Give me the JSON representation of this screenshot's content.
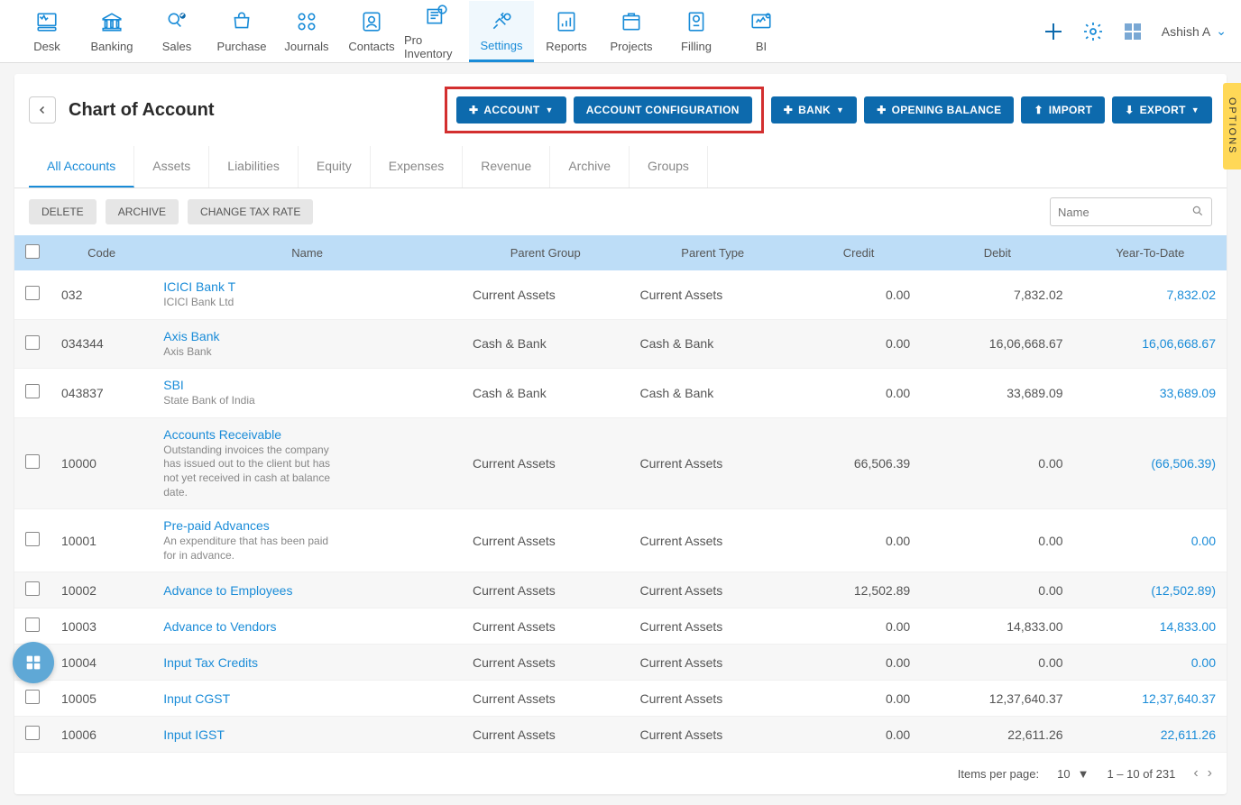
{
  "nav": {
    "items": [
      {
        "label": "Desk"
      },
      {
        "label": "Banking"
      },
      {
        "label": "Sales"
      },
      {
        "label": "Purchase"
      },
      {
        "label": "Journals"
      },
      {
        "label": "Contacts"
      },
      {
        "label": "Pro Inventory"
      },
      {
        "label": "Settings"
      },
      {
        "label": "Reports"
      },
      {
        "label": "Projects"
      },
      {
        "label": "Filling"
      },
      {
        "label": "BI"
      }
    ],
    "user": "Ashish A"
  },
  "page_title": "Chart of Account",
  "actions": {
    "account": "ACCOUNT",
    "config": "ACCOUNT CONFIGURATION",
    "bank": "BANK",
    "opening": "OPENING BALANCE",
    "import": "IMPORT",
    "export": "EXPORT"
  },
  "subtabs": [
    "All Accounts",
    "Assets",
    "Liabilities",
    "Equity",
    "Expenses",
    "Revenue",
    "Archive",
    "Groups"
  ],
  "toolbar": {
    "delete": "DELETE",
    "archive": "ARCHIVE",
    "change_tax": "CHANGE TAX RATE",
    "search_placeholder": "Name"
  },
  "columns": {
    "code": "Code",
    "name": "Name",
    "parent_group": "Parent Group",
    "parent_type": "Parent Type",
    "credit": "Credit",
    "debit": "Debit",
    "ytd": "Year-To-Date"
  },
  "rows": [
    {
      "code": "032",
      "name": "ICICI Bank T",
      "desc": "ICICI Bank Ltd",
      "pg": "Current Assets",
      "pt": "Current Assets",
      "credit": "0.00",
      "debit": "7,832.02",
      "ytd": "7,832.02"
    },
    {
      "code": "034344",
      "name": "Axis Bank",
      "desc": "Axis Bank",
      "pg": "Cash & Bank",
      "pt": "Cash & Bank",
      "credit": "0.00",
      "debit": "16,06,668.67",
      "ytd": "16,06,668.67"
    },
    {
      "code": "043837",
      "name": "SBI",
      "desc": "State Bank of India",
      "pg": "Cash & Bank",
      "pt": "Cash & Bank",
      "credit": "0.00",
      "debit": "33,689.09",
      "ytd": "33,689.09"
    },
    {
      "code": "10000",
      "name": "Accounts Receivable",
      "desc": "Outstanding invoices the company has issued out to the client but has not yet received in cash at balance date.",
      "pg": "Current Assets",
      "pt": "Current Assets",
      "credit": "66,506.39",
      "debit": "0.00",
      "ytd": "(66,506.39)"
    },
    {
      "code": "10001",
      "name": "Pre-paid Advances",
      "desc": "An expenditure that has been paid for in advance.",
      "pg": "Current Assets",
      "pt": "Current Assets",
      "credit": "0.00",
      "debit": "0.00",
      "ytd": "0.00"
    },
    {
      "code": "10002",
      "name": "Advance to Employees",
      "desc": "",
      "pg": "Current Assets",
      "pt": "Current Assets",
      "credit": "12,502.89",
      "debit": "0.00",
      "ytd": "(12,502.89)"
    },
    {
      "code": "10003",
      "name": "Advance to Vendors",
      "desc": "",
      "pg": "Current Assets",
      "pt": "Current Assets",
      "credit": "0.00",
      "debit": "14,833.00",
      "ytd": "14,833.00"
    },
    {
      "code": "10004",
      "name": "Input Tax Credits",
      "desc": "",
      "pg": "Current Assets",
      "pt": "Current Assets",
      "credit": "0.00",
      "debit": "0.00",
      "ytd": "0.00"
    },
    {
      "code": "10005",
      "name": "Input CGST",
      "desc": "",
      "pg": "Current Assets",
      "pt": "Current Assets",
      "credit": "0.00",
      "debit": "12,37,640.37",
      "ytd": "12,37,640.37"
    },
    {
      "code": "10006",
      "name": "Input IGST",
      "desc": "",
      "pg": "Current Assets",
      "pt": "Current Assets",
      "credit": "0.00",
      "debit": "22,611.26",
      "ytd": "22,611.26"
    }
  ],
  "pagination": {
    "label": "Items per page:",
    "per_page": "10",
    "range": "1 – 10 of 231"
  },
  "options_tab": "OPTIONS"
}
